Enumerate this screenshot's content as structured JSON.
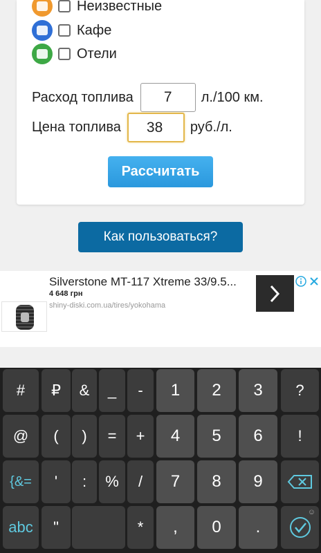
{
  "poi": [
    {
      "label": "Неизвестные",
      "color": "#f0992e"
    },
    {
      "label": "Кафе",
      "color": "#2f6fd6"
    },
    {
      "label": "Отели",
      "color": "#3da845"
    }
  ],
  "fuel": {
    "consumption_label": "Расход топлива",
    "consumption_value": "7",
    "consumption_unit": "л./100 км.",
    "price_label": "Цена топлива",
    "price_value": "38",
    "price_unit": "руб./л."
  },
  "buttons": {
    "calculate": "Рассчитать",
    "howto": "Как пользоваться?"
  },
  "ad": {
    "title": "Silverstone MT-117 Xtreme 33/9.5...",
    "price": "4 648 грн",
    "url": "shiny-diski.com.ua/tires/yokohama",
    "info_color": "#26a9e0"
  },
  "keyboard": {
    "row1": [
      "#",
      "₽",
      "&",
      "_",
      "-",
      "1",
      "2",
      "3",
      "?"
    ],
    "row2": [
      "@",
      "(",
      ")",
      "=",
      "+",
      "4",
      "5",
      "6",
      "!"
    ],
    "row3": [
      "{&=",
      "'",
      ":",
      "%",
      "/",
      "7",
      "8",
      "9",
      "⌫"
    ],
    "row4": [
      "abc",
      "\"",
      "",
      "*",
      ",",
      "0",
      ".",
      "✓"
    ],
    "corner_hint": "☺"
  }
}
